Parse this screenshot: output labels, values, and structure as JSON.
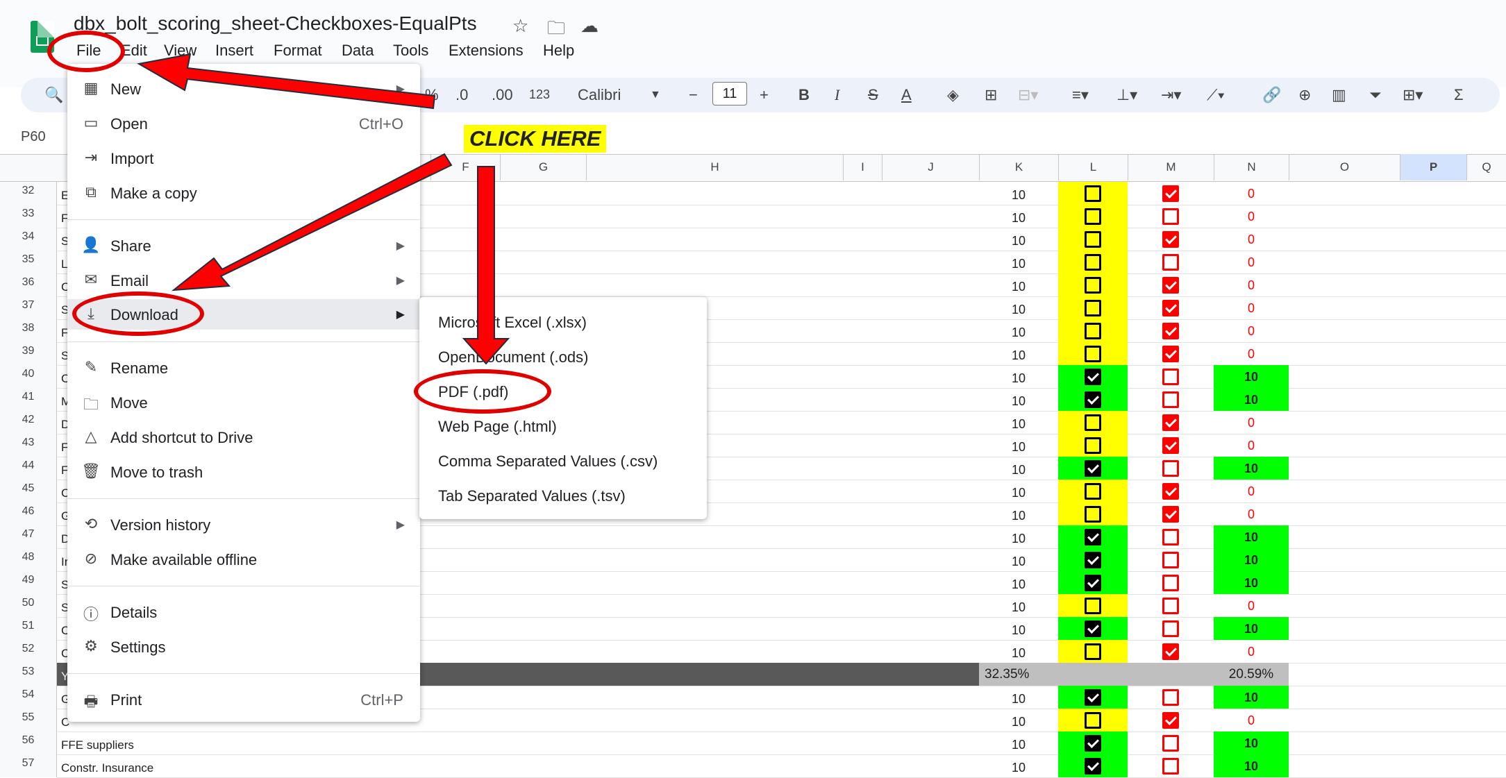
{
  "doc": {
    "title": "dbx_bolt_scoring_sheet-Checkboxes-EqualPts",
    "menu": [
      "File",
      "Edit",
      "View",
      "Insert",
      "Format",
      "Data",
      "Tools",
      "Extensions",
      "Help"
    ]
  },
  "toolbar": {
    "percent": "%",
    "decrease_decimal": ".0",
    "increase_decimal": ".00",
    "format_123": "123",
    "font": "Calibri",
    "font_size": "11",
    "minus": "−",
    "plus": "+",
    "bold": "B",
    "italic": "I",
    "strike": "S",
    "text_color": "A",
    "sigma": "Σ"
  },
  "name_box": "P60",
  "callout": "CLICK HERE",
  "columns": [
    "F",
    "G",
    "H",
    "I",
    "J",
    "K",
    "L",
    "M",
    "N",
    "O",
    "P",
    "Q"
  ],
  "rows": [
    {
      "num": "32",
      "a": "E",
      "k": "10",
      "l": false,
      "m": true,
      "n": "0"
    },
    {
      "num": "33",
      "a": "F",
      "k": "10",
      "l": false,
      "m": false,
      "n": "0"
    },
    {
      "num": "34",
      "a": "S",
      "k": "10",
      "l": false,
      "m": true,
      "n": "0"
    },
    {
      "num": "35",
      "a": "L",
      "k": "10",
      "l": false,
      "m": false,
      "n": "0"
    },
    {
      "num": "36",
      "a": "C",
      "k": "10",
      "l": false,
      "m": true,
      "n": "0"
    },
    {
      "num": "37",
      "a": "S",
      "k": "10",
      "l": false,
      "m": true,
      "n": "0"
    },
    {
      "num": "38",
      "a": "F",
      "k": "10",
      "l": false,
      "m": true,
      "n": "0"
    },
    {
      "num": "39",
      "a": "S",
      "k": "10",
      "l": false,
      "m": true,
      "n": "0"
    },
    {
      "num": "40",
      "a": "C",
      "k": "10",
      "l": true,
      "m": false,
      "n": "10"
    },
    {
      "num": "41",
      "a": "M",
      "k": "10",
      "l": true,
      "m": false,
      "n": "10"
    },
    {
      "num": "42",
      "a": "D",
      "k": "10",
      "l": false,
      "m": true,
      "n": "0"
    },
    {
      "num": "43",
      "a": "F",
      "k": "10",
      "l": false,
      "m": true,
      "n": "0"
    },
    {
      "num": "44",
      "a": "F",
      "k": "10",
      "l": true,
      "m": false,
      "n": "10"
    },
    {
      "num": "45",
      "a": "C",
      "k": "10",
      "l": false,
      "m": true,
      "n": "0"
    },
    {
      "num": "46",
      "a": "G",
      "k": "10",
      "l": false,
      "m": true,
      "n": "0"
    },
    {
      "num": "47",
      "a": "D",
      "k": "10",
      "l": true,
      "m": false,
      "n": "10"
    },
    {
      "num": "48",
      "a": "Ir",
      "k": "10",
      "l": true,
      "m": false,
      "n": "10"
    },
    {
      "num": "49",
      "a": "S",
      "k": "10",
      "l": true,
      "m": false,
      "n": "10"
    },
    {
      "num": "50",
      "a": "S",
      "k": "10",
      "l": false,
      "m": false,
      "n": "0"
    },
    {
      "num": "51",
      "a": "C",
      "k": "10",
      "l": true,
      "m": false,
      "n": "10"
    },
    {
      "num": "52",
      "a": "C",
      "k": "10",
      "l": false,
      "m": true,
      "n": "0"
    },
    {
      "num": "53",
      "a": "Y",
      "k": "32.35%",
      "l": null,
      "m": null,
      "n": "20.59%"
    },
    {
      "num": "54",
      "a": "G",
      "k": "10",
      "l": true,
      "m": false,
      "n": "10"
    },
    {
      "num": "55",
      "a": "C",
      "k": "10",
      "l": false,
      "m": true,
      "n": "0"
    },
    {
      "num": "56",
      "a": "FFE suppliers",
      "k": "10",
      "l": true,
      "m": false,
      "n": "10"
    },
    {
      "num": "57",
      "a": "Constr. Insurance",
      "k": "10",
      "l": true,
      "m": false,
      "n": "10"
    }
  ],
  "file_menu": {
    "new": "New",
    "open": "Open",
    "open_shortcut": "Ctrl+O",
    "import": "Import",
    "make_copy": "Make a copy",
    "share": "Share",
    "email": "Email",
    "download": "Download",
    "rename": "Rename",
    "move": "Move",
    "add_shortcut": "Add shortcut to Drive",
    "move_trash": "Move to trash",
    "version_history": "Version history",
    "make_offline": "Make available offline",
    "details": "Details",
    "settings": "Settings",
    "print": "Print",
    "print_shortcut": "Ctrl+P"
  },
  "download_menu": {
    "xlsx": "Microsoft Excel (.xlsx)",
    "ods": "OpenDocument (.ods)",
    "pdf": "PDF (.pdf)",
    "html": "Web Page (.html)",
    "csv": "Comma Separated Values (.csv)",
    "tsv": "Tab Separated Values (.tsv)"
  },
  "colors": {
    "yellow": "#ffff00",
    "green": "#00ff00",
    "annotation_red": "#e00000",
    "dark_row": "#595959",
    "gray_cell": "#bfbfbf"
  }
}
